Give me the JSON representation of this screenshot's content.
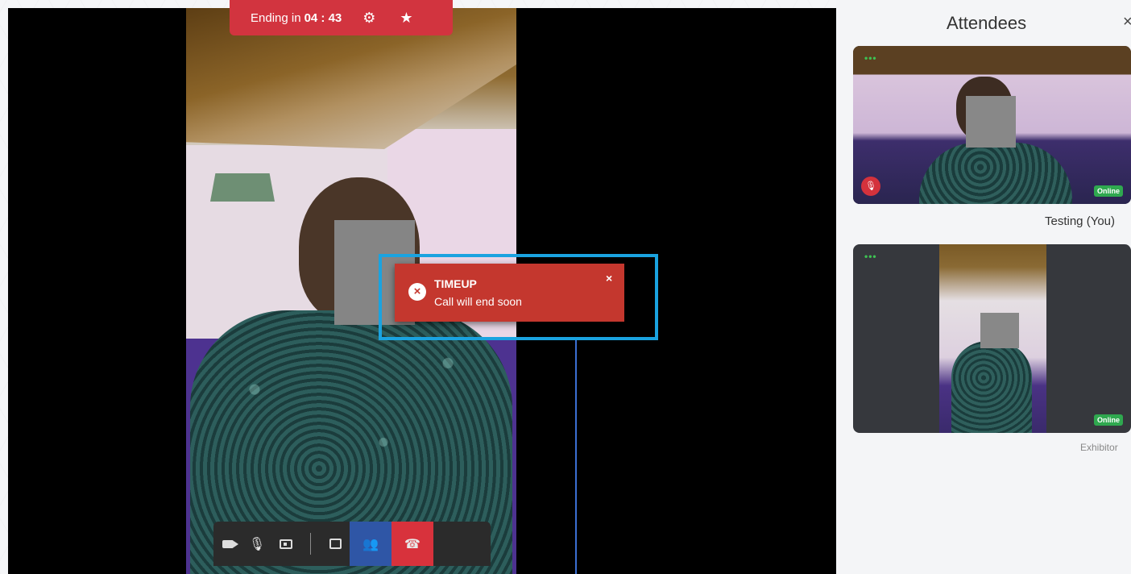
{
  "timer": {
    "label": "Ending in",
    "value": "04 : 43",
    "icons": [
      "gear-icon",
      "star-icon"
    ]
  },
  "toast": {
    "title": "TIMEUP",
    "message": "Call will end soon",
    "close": "×",
    "icon": "error-circle-icon",
    "color": "#c4372e"
  },
  "controls": {
    "items": [
      "video-camera-icon",
      "mic-off-icon",
      "screen-share-icon",
      "chat-icon",
      "participants-icon",
      "end-call-icon"
    ],
    "active_color": "#2f56a6",
    "end_color": "#d8323c"
  },
  "sidebar": {
    "title": "Attendees",
    "close": "×",
    "attendees": [
      {
        "name": "Testing (You)",
        "status": "Online",
        "dots": "•••"
      },
      {
        "name": "Exhibitor",
        "status": "Online",
        "dots": "•••"
      }
    ]
  },
  "colors": {
    "timer_bar": "#d2343f",
    "highlight": "#1aa3e0",
    "online": "#2fa84f"
  }
}
